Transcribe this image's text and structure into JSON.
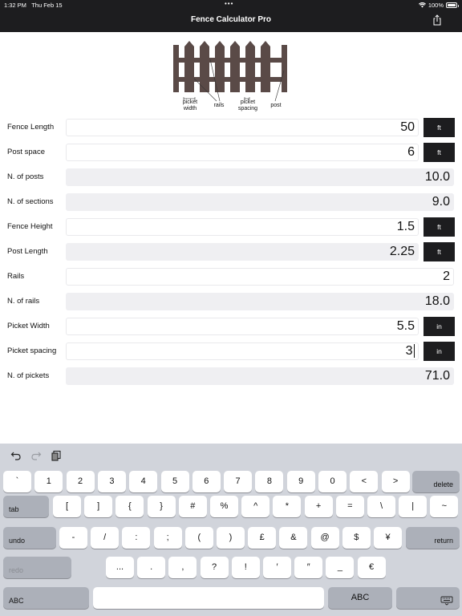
{
  "status_bar": {
    "time": "1:32 PM",
    "date": "Thu Feb 15",
    "dots": "•••",
    "battery": "100%"
  },
  "nav": {
    "title": "Fence Calculator Pro",
    "share_icon": "share-icon"
  },
  "diagram": {
    "labels": {
      "picket_width": "picket\nwidth",
      "rails": "rails",
      "picket_spacing": "picket\nspacing",
      "post": "post"
    },
    "fence_color": "#5a4a47"
  },
  "rows": [
    {
      "label": "Fence Length",
      "value": "50",
      "unit": "ft",
      "editable": true
    },
    {
      "label": "Post space",
      "value": "6",
      "unit": "ft",
      "editable": true
    },
    {
      "label": "N. of posts",
      "value": "10.0",
      "unit": "",
      "editable": false
    },
    {
      "label": "N. of sections",
      "value": "9.0",
      "unit": "",
      "editable": false
    },
    {
      "label": "Fence Height",
      "value": "1.5",
      "unit": "ft",
      "editable": true
    },
    {
      "label": "Post Length",
      "value": "2.25",
      "unit": "ft",
      "editable": false
    },
    {
      "label": "Rails",
      "value": "2",
      "unit": "",
      "editable": true
    },
    {
      "label": "N. of rails",
      "value": "18.0",
      "unit": "",
      "editable": false
    },
    {
      "label": "Picket Width",
      "value": "5.5",
      "unit": "in",
      "editable": true
    },
    {
      "label": "Picket spacing",
      "value": "3",
      "unit": "in",
      "editable": true,
      "focused": true
    },
    {
      "label": "N. of pickets",
      "value": "71.0",
      "unit": "",
      "editable": false
    }
  ],
  "keyboard": {
    "toolbar": [
      "undo-icon",
      "redo-icon",
      "clipboard-icon"
    ],
    "row1": [
      "`",
      "1",
      "2",
      "3",
      "4",
      "5",
      "6",
      "7",
      "8",
      "9",
      "0",
      "<",
      ">"
    ],
    "delete": "delete",
    "tab": "tab",
    "row2": [
      "[",
      "]",
      "{",
      "}",
      "#",
      "%",
      "^",
      "*",
      "+",
      "=",
      "\\",
      "|",
      "~"
    ],
    "undo": "undo",
    "row3": [
      "-",
      "/",
      ":",
      ";",
      "(",
      ")",
      "£",
      "&",
      "@",
      "$",
      "¥"
    ],
    "return": "return",
    "redo": "redo",
    "row4": [
      "...",
      ".",
      ",",
      "?",
      "!",
      "′",
      "″",
      "_",
      "€"
    ],
    "abc_left": "ABC",
    "abc_right": "ABC",
    "keyboard_icon": "keyboard-dismiss-icon"
  }
}
